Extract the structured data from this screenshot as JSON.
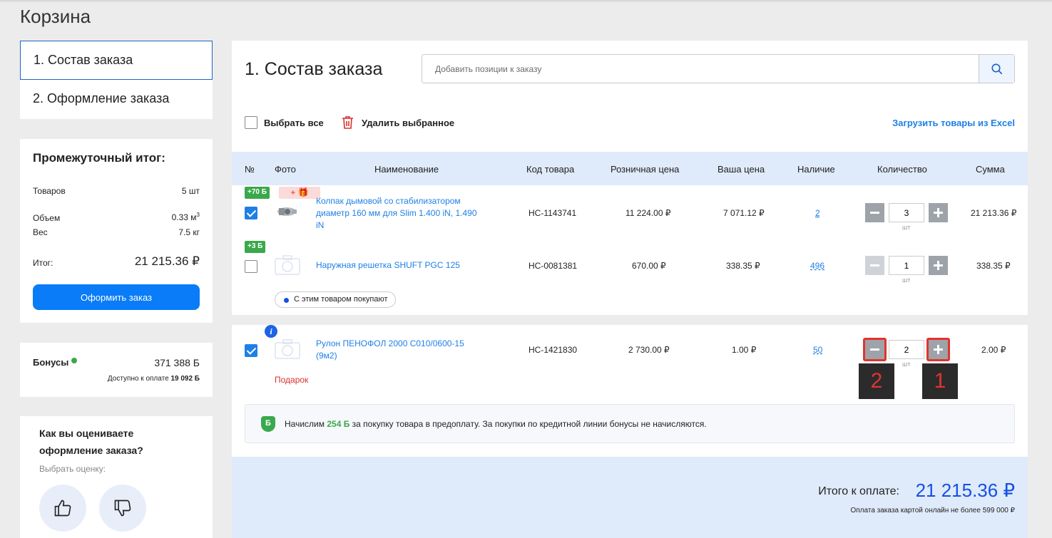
{
  "page": {
    "title": "Корзина"
  },
  "steps": {
    "step1": "1. Состав заказа",
    "step2": "2. Оформление заказа"
  },
  "subtotal": {
    "title": "Промежуточный итог:",
    "items_label": "Товаров",
    "items_value": "5 шт",
    "volume_label": "Объем",
    "volume_value": "0.33 м",
    "volume_sup": "3",
    "weight_label": "Вес",
    "weight_value": "7.5 кг",
    "total_label": "Итог:",
    "total_value": "21 215.36 ₽",
    "checkout_button": "Оформить заказ"
  },
  "bonus": {
    "label": "Бонусы",
    "value": "371 388 Б",
    "available_label": "Доступно к оплате",
    "available_value": "19 092 Б"
  },
  "rating": {
    "question": "Как вы оцениваете оформление заказа?",
    "select_label": "Выбрать оценку:"
  },
  "main": {
    "heading": "1. Состав заказа",
    "search_placeholder": "Добавить позиции к заказу",
    "select_all": "Выбрать все",
    "delete_selected": "Удалить выбранное",
    "upload_excel": "Загрузить товары из Excel"
  },
  "table": {
    "headers": {
      "num": "№",
      "photo": "Фото",
      "name": "Наименование",
      "code": "Код товара",
      "retail": "Розничная цена",
      "your_price": "Ваша цена",
      "availability": "Наличие",
      "quantity": "Количество",
      "sum": "Сумма"
    },
    "unit": "шт",
    "rows": [
      {
        "bonus_badge": "+70 Б",
        "gift_badge": "+ 🎁",
        "name": "Колпак дымовой со стабилизатором диаметр 160 мм для Slim 1.400 iN, 1.490 iN",
        "code": "НС-1143741",
        "retail": "11 224.00 ₽",
        "price": "7 071.12 ₽",
        "availability": "2",
        "qty": "3",
        "sum": "21 213.36 ₽",
        "checked": true
      },
      {
        "bonus_badge": "+3 Б",
        "name": "Наружная решетка SHUFT PGC 125",
        "code": "НС-0081381",
        "retail": "670.00 ₽",
        "price": "338.35 ₽",
        "availability": "496",
        "qty": "1",
        "sum": "338.35 ₽",
        "checked": false
      },
      {
        "name": "Рулон ПЕНОФОЛ 2000 С010/0600-15 (9м2)",
        "code": "НС-1421830",
        "retail": "2 730.00 ₽",
        "price": "1.00 ₽",
        "availability": "50",
        "qty": "2",
        "sum": "2.00 ₽",
        "checked": true,
        "gift_label": "Подарок"
      }
    ],
    "buy_with": "С этим товаром покупают"
  },
  "annotations": {
    "plus_tag": "1",
    "minus_tag": "2"
  },
  "notice": {
    "icon_letter": "Б",
    "before": "Начислим",
    "amount": "254 Б",
    "after": "за покупку товара в предоплату. За покупки по кредитной линии бонусы не начисляются."
  },
  "footer": {
    "total_label": "Итого к оплате:",
    "total_value": "21 215.36 ₽",
    "note": "Оплата заказа картой онлайн не более 599 000 ₽"
  },
  "colors": {
    "accent": "#1e80e6",
    "button": "#0a7cf7",
    "green": "#3aa84c",
    "red": "#e0342e",
    "header_bg": "#dfeafa"
  }
}
